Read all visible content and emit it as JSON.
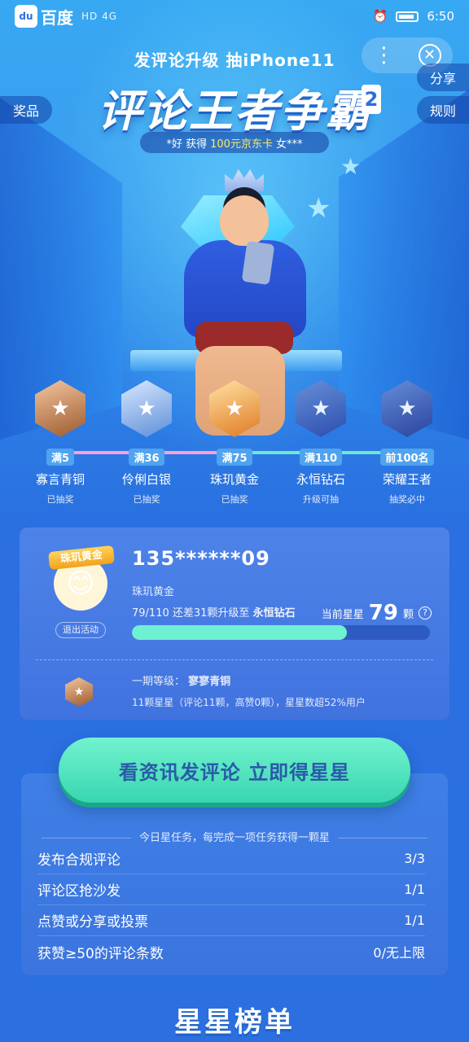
{
  "status_bar": {
    "app_name": "百度",
    "network": "HD 4G",
    "time": "6:50"
  },
  "hero": {
    "subtitle": "发评论升级 抽iPhone11",
    "title": "评论王者争霸",
    "title_badge": "2",
    "ticker": {
      "prefix": "*好 获得",
      "highlight": "100元京东卡",
      "suffix": "女***"
    }
  },
  "side_tabs": {
    "prizes": "奖品",
    "share": "分享",
    "rules": "规则"
  },
  "top_controls": {
    "more": "⋮",
    "close": "✕"
  },
  "ranks": [
    {
      "threshold": "满5",
      "name": "寡言青铜",
      "status": "已抽奖"
    },
    {
      "threshold": "满36",
      "name": "伶俐白银",
      "status": "已抽奖"
    },
    {
      "threshold": "满75",
      "name": "珠玑黄金",
      "status": "已抽奖"
    },
    {
      "threshold": "满110",
      "name": "永恒钻石",
      "status": "升级可抽"
    },
    {
      "threshold": "前100名",
      "name": "荣耀王者",
      "status": "抽奖必中"
    }
  ],
  "profile": {
    "ribbon": "珠玑黄金",
    "quit": "退出活动",
    "username": "135******09",
    "level": "珠玑黄金",
    "progress_text": "79/110 还差31颗升级至",
    "next_level": "永恒钻石",
    "star_label": "当前星星",
    "star_count": "79",
    "star_unit": "颗",
    "help": "?",
    "progress": 0.72,
    "prev_label": "一期等级：",
    "prev_value": "寥寥青铜",
    "prev_detail": "11颗星星（评论11颗，高赞0颗），星星数超52%用户"
  },
  "cta": {
    "label": "看资讯发评论 立即得星星"
  },
  "tasks": {
    "title": "今日星任务，每完成一项任务获得一颗星",
    "items": [
      {
        "name": "发布合规评论",
        "value": "3/3"
      },
      {
        "name": "评论区抢沙发",
        "value": "1/1"
      },
      {
        "name": "点赞或分享或投票",
        "value": "1/1"
      },
      {
        "name": "获赞≥50的评论条数",
        "value": "0/无上限"
      }
    ]
  },
  "leaderboard": {
    "title": "星星榜单"
  }
}
